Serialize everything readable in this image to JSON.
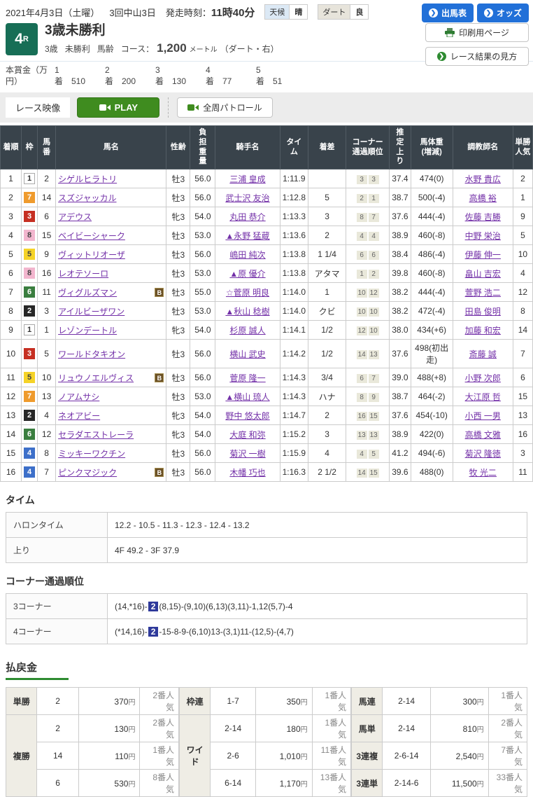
{
  "header": {
    "date": "2021年4月3日（土曜）",
    "meeting": "3回中山3日",
    "start_label": "発走時刻：",
    "start_time": "11時40分",
    "weather": {
      "label": "天候",
      "value": "晴"
    },
    "track": {
      "label": "ダート",
      "value": "良"
    },
    "btn_shutsuba": "出馬表",
    "btn_odds": "オッズ",
    "btn_print": "印刷用ページ",
    "btn_guide": "レース結果の見方",
    "race_no": "4",
    "race_no_suffix": "R",
    "title": "3歳未勝利",
    "cond_age": "3歳",
    "cond_class": "未勝利",
    "cond_weight": "馬齢",
    "course_label": "コース：",
    "course_value": "1,200",
    "course_unit": "メートル",
    "course_note": "（ダート・右）"
  },
  "prize": {
    "label": "本賞金（万円）",
    "place_suffix": "着",
    "items": [
      {
        "place": "1",
        "amount": "510"
      },
      {
        "place": "2",
        "amount": "200"
      },
      {
        "place": "3",
        "amount": "130"
      },
      {
        "place": "4",
        "amount": "77"
      },
      {
        "place": "5",
        "amount": "51"
      }
    ]
  },
  "video": {
    "tab": "レース映像",
    "play": "PLAY",
    "patrol": "全周パトロール"
  },
  "results": {
    "headers": [
      "着順",
      "枠",
      "馬\n番",
      "馬名",
      "性齢",
      "負\n担\n重\n量",
      "騎手名",
      "タイ\nム",
      "着差",
      "コーナー\n通過順位",
      "推\n定\n上\nり",
      "馬体重\n(増減)",
      "調教師名",
      "単勝\n人気"
    ],
    "rows": [
      {
        "rank": "1",
        "frame": "1",
        "num": "2",
        "name": "シゲルヒラトリ",
        "blinker": false,
        "sexage": "牡3",
        "weight": "56.0",
        "jockey": "三浦 皇成",
        "time": "1:11.9",
        "margin": "",
        "corners": [
          "3",
          "3"
        ],
        "agari": "37.4",
        "body_weight": "474(0)",
        "trainer": "水野 貴広",
        "pop": "2"
      },
      {
        "rank": "2",
        "frame": "7",
        "num": "14",
        "name": "スズジャッカル",
        "blinker": false,
        "sexage": "牡3",
        "weight": "56.0",
        "jockey": "武士沢 友治",
        "time": "1:12.8",
        "margin": "5",
        "corners": [
          "2",
          "1"
        ],
        "agari": "38.7",
        "body_weight": "500(-4)",
        "trainer": "高橋 裕",
        "pop": "1"
      },
      {
        "rank": "3",
        "frame": "3",
        "num": "6",
        "name": "アデウス",
        "blinker": false,
        "sexage": "牝3",
        "weight": "54.0",
        "jockey": "丸田 恭介",
        "time": "1:13.3",
        "margin": "3",
        "corners": [
          "8",
          "7"
        ],
        "agari": "37.6",
        "body_weight": "444(-4)",
        "trainer": "佐藤 吉勝",
        "pop": "9"
      },
      {
        "rank": "4",
        "frame": "8",
        "num": "15",
        "name": "ベイビーシャーク",
        "blinker": false,
        "sexage": "牡3",
        "weight": "53.0",
        "jockey": "▲永野 猛蔵",
        "time": "1:13.6",
        "margin": "2",
        "corners": [
          "4",
          "4"
        ],
        "agari": "38.9",
        "body_weight": "460(-8)",
        "trainer": "中野 栄治",
        "pop": "5"
      },
      {
        "rank": "5",
        "frame": "5",
        "num": "9",
        "name": "ヴィットリオーザ",
        "blinker": false,
        "sexage": "牡3",
        "weight": "56.0",
        "jockey": "嶋田 純次",
        "time": "1:13.8",
        "margin": "1 1/4",
        "corners": [
          "6",
          "6"
        ],
        "agari": "38.4",
        "body_weight": "486(-4)",
        "trainer": "伊藤 伸一",
        "pop": "10"
      },
      {
        "rank": "6",
        "frame": "8",
        "num": "16",
        "name": "レオテソーロ",
        "blinker": false,
        "sexage": "牡3",
        "weight": "53.0",
        "jockey": "▲原 優介",
        "time": "1:13.8",
        "margin": "アタマ",
        "corners": [
          "1",
          "2"
        ],
        "agari": "39.8",
        "body_weight": "460(-8)",
        "trainer": "畠山 吉宏",
        "pop": "4"
      },
      {
        "rank": "7",
        "frame": "6",
        "num": "11",
        "name": "ヴィグルズマン",
        "blinker": true,
        "sexage": "牡3",
        "weight": "55.0",
        "jockey": "☆菅原 明良",
        "time": "1:14.0",
        "margin": "1",
        "corners": [
          "10",
          "12"
        ],
        "agari": "38.2",
        "body_weight": "444(-4)",
        "trainer": "萱野 浩二",
        "pop": "12"
      },
      {
        "rank": "8",
        "frame": "2",
        "num": "3",
        "name": "アイルビーザワン",
        "blinker": false,
        "sexage": "牡3",
        "weight": "53.0",
        "jockey": "▲秋山 稔樹",
        "time": "1:14.0",
        "margin": "クビ",
        "corners": [
          "10",
          "10"
        ],
        "agari": "38.2",
        "body_weight": "472(-4)",
        "trainer": "田島 俊明",
        "pop": "8"
      },
      {
        "rank": "9",
        "frame": "1",
        "num": "1",
        "name": "レゾンデートル",
        "blinker": false,
        "sexage": "牝3",
        "weight": "54.0",
        "jockey": "杉原 誠人",
        "time": "1:14.1",
        "margin": "1/2",
        "corners": [
          "12",
          "10"
        ],
        "agari": "38.0",
        "body_weight": "434(+6)",
        "trainer": "加藤 和宏",
        "pop": "14"
      },
      {
        "rank": "10",
        "frame": "3",
        "num": "5",
        "name": "ワールドタキオン",
        "blinker": false,
        "sexage": "牡3",
        "weight": "56.0",
        "jockey": "横山 武史",
        "time": "1:14.2",
        "margin": "1/2",
        "corners": [
          "14",
          "13"
        ],
        "agari": "37.6",
        "body_weight": "498(初出走)",
        "trainer": "斎藤 誠",
        "pop": "7"
      },
      {
        "rank": "11",
        "frame": "5",
        "num": "10",
        "name": "リュウノエルヴィス",
        "blinker": true,
        "sexage": "牡3",
        "weight": "56.0",
        "jockey": "菅原 隆一",
        "time": "1:14.3",
        "margin": "3/4",
        "corners": [
          "6",
          "7"
        ],
        "agari": "39.0",
        "body_weight": "488(+8)",
        "trainer": "小野 次郎",
        "pop": "6"
      },
      {
        "rank": "12",
        "frame": "7",
        "num": "13",
        "name": "ノアムサシ",
        "blinker": false,
        "sexage": "牡3",
        "weight": "53.0",
        "jockey": "▲横山 琉人",
        "time": "1:14.3",
        "margin": "ハナ",
        "corners": [
          "8",
          "9"
        ],
        "agari": "38.7",
        "body_weight": "464(-2)",
        "trainer": "大江原 哲",
        "pop": "15"
      },
      {
        "rank": "13",
        "frame": "2",
        "num": "4",
        "name": "ネオアビー",
        "blinker": false,
        "sexage": "牝3",
        "weight": "54.0",
        "jockey": "野中 悠太郎",
        "time": "1:14.7",
        "margin": "2",
        "corners": [
          "16",
          "15"
        ],
        "agari": "37.6",
        "body_weight": "454(-10)",
        "trainer": "小西 一男",
        "pop": "13"
      },
      {
        "rank": "14",
        "frame": "6",
        "num": "12",
        "name": "セラダエストレーラ",
        "blinker": false,
        "sexage": "牝3",
        "weight": "54.0",
        "jockey": "大庭 和弥",
        "time": "1:15.2",
        "margin": "3",
        "corners": [
          "13",
          "13"
        ],
        "agari": "38.9",
        "body_weight": "422(0)",
        "trainer": "高橋 文雅",
        "pop": "16"
      },
      {
        "rank": "15",
        "frame": "4",
        "num": "8",
        "name": "ミッキーワクチン",
        "blinker": false,
        "sexage": "牡3",
        "weight": "56.0",
        "jockey": "菊沢 一樹",
        "time": "1:15.9",
        "margin": "4",
        "corners": [
          "4",
          "5"
        ],
        "agari": "41.2",
        "body_weight": "494(-6)",
        "trainer": "菊沢 隆徳",
        "pop": "3"
      },
      {
        "rank": "16",
        "frame": "4",
        "num": "7",
        "name": "ピンクマジック",
        "blinker": true,
        "sexage": "牡3",
        "weight": "56.0",
        "jockey": "木幡 巧也",
        "time": "1:16.3",
        "margin": "2 1/2",
        "corners": [
          "14",
          "15"
        ],
        "agari": "39.6",
        "body_weight": "488(0)",
        "trainer": "牧 光二",
        "pop": "11"
      }
    ]
  },
  "time_section": {
    "title": "タイム",
    "rows": [
      {
        "label": "ハロンタイム",
        "value": "12.2 - 10.5 - 11.3 - 12.3 - 12.4 - 13.2"
      },
      {
        "label": "上り",
        "value": "4F 49.2 - 3F 37.9"
      }
    ]
  },
  "corner_section": {
    "title": "コーナー通過順位",
    "rows": [
      {
        "label": "3コーナー",
        "pre": "(14,*16)-",
        "highlight": "2",
        "post": "(8,15)-(9,10)(6,13)(3,11)-1,12(5,7)-4"
      },
      {
        "label": "4コーナー",
        "pre": "(*14,16)-",
        "highlight": "2",
        "post": "-15-8-9-(6,10)13-(3,1)11-(12,5)-(4,7)"
      }
    ]
  },
  "payout": {
    "title": "払戻金",
    "unit_amount": "円",
    "unit_pop": "番人気",
    "col1": [
      {
        "label": "単勝",
        "rows": [
          {
            "comb": "2",
            "amount": "370",
            "pop": "2"
          }
        ]
      },
      {
        "label": "複勝",
        "rows": [
          {
            "comb": "2",
            "amount": "130",
            "pop": "2"
          },
          {
            "comb": "14",
            "amount": "110",
            "pop": "1"
          },
          {
            "comb": "6",
            "amount": "530",
            "pop": "8"
          }
        ]
      }
    ],
    "col2": [
      {
        "label": "枠連",
        "rows": [
          {
            "comb": "1-7",
            "amount": "350",
            "pop": "1"
          }
        ]
      },
      {
        "label": "ワイド",
        "rows": [
          {
            "comb": "2-14",
            "amount": "180",
            "pop": "1"
          },
          {
            "comb": "2-6",
            "amount": "1,010",
            "pop": "11"
          },
          {
            "comb": "6-14",
            "amount": "1,170",
            "pop": "13"
          }
        ]
      }
    ],
    "col3": [
      {
        "label": "馬連",
        "rows": [
          {
            "comb": "2-14",
            "amount": "300",
            "pop": "1"
          }
        ]
      },
      {
        "label": "馬単",
        "rows": [
          {
            "comb": "2-14",
            "amount": "810",
            "pop": "2"
          }
        ]
      },
      {
        "label": "3連複",
        "rows": [
          {
            "comb": "2-6-14",
            "amount": "2,540",
            "pop": "7"
          }
        ]
      },
      {
        "label": "3連単",
        "rows": [
          {
            "comb": "2-14-6",
            "amount": "11,500",
            "pop": "33"
          }
        ]
      }
    ]
  }
}
